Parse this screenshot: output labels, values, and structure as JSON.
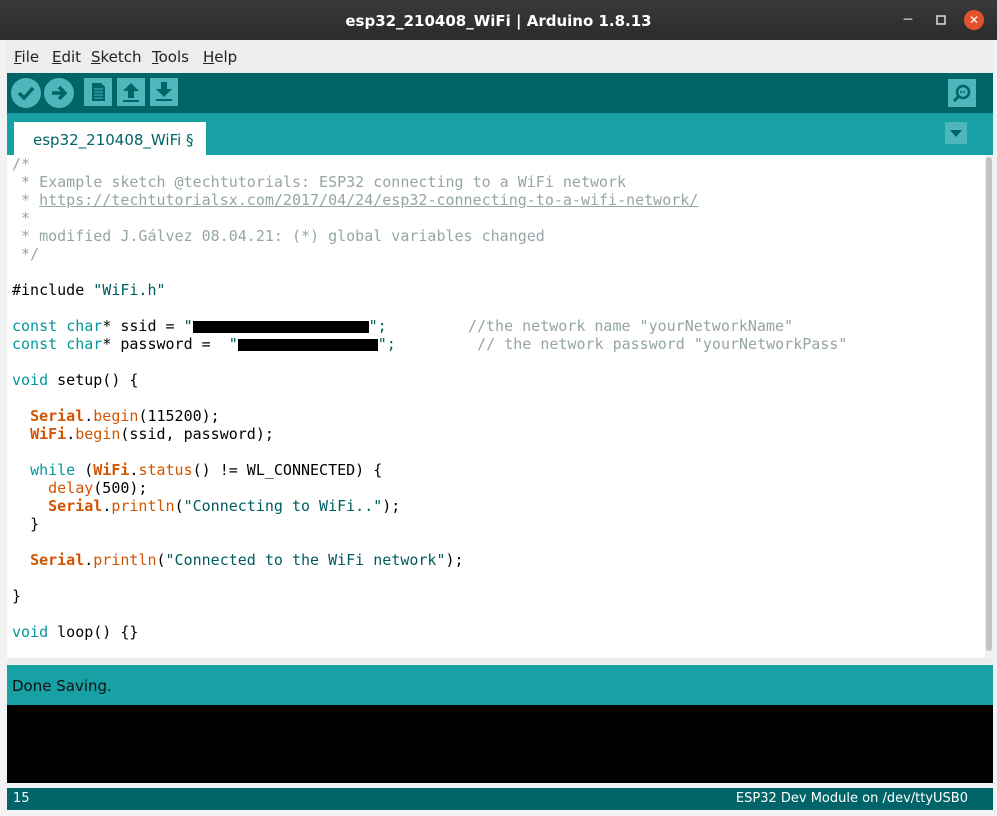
{
  "window": {
    "title": "esp32_210408_WiFi | Arduino 1.8.13"
  },
  "menu": [
    {
      "mnemonic": "F",
      "rest": "ile"
    },
    {
      "mnemonic": "E",
      "rest": "dit"
    },
    {
      "mnemonic": "S",
      "rest": "ketch"
    },
    {
      "mnemonic": "T",
      "rest": "ools"
    },
    {
      "mnemonic": "H",
      "rest": "elp"
    }
  ],
  "tab": {
    "label": "esp32_210408_WiFi §"
  },
  "code": {
    "l1": "/*",
    "l2": " * Example sketch @techtutorials: ESP32 connecting to a WiFi network",
    "l3_prefix": " * ",
    "l3_url": "https://techtutorialsx.com/2017/04/24/esp32-connecting-to-a-wifi-network/",
    "l4": " *",
    "l5": " * modified J.Gálvez 08.04.21: (*) global variables changed",
    "l6": " */",
    "inc_kw": "#include",
    "inc_str": " \"WiFi.h\"",
    "const": "const",
    "char": "char",
    "ssid_mid": "* ssid = ",
    "password_mid": "* password =  ",
    "q": "\"",
    "end_q": "\";",
    "ssid_comment": "         //the network name \"yourNetworkName\"",
    "pass_comment": "         // the network password \"yourNetworkPass\"",
    "void": "void",
    "setup_sig": " setup() {",
    "serial": "Serial",
    "wifi": "WiFi",
    "begin": "begin",
    "baud": "(115200);",
    "wifi_args": "(ssid, password);",
    "while": "while",
    "status": "status",
    "status_rest": "() != WL_CONNECTED) {",
    "delay": "delay",
    "delay_args": "(500);",
    "println": "println",
    "connecting_str": "\"Connecting to WiFi..\"",
    "connected_str": "\"Connected to the WiFi network\"",
    "close_paren": ");",
    "brace_close": "}",
    "loop_sig": " loop() {}"
  },
  "status_message": "Done Saving.",
  "footer": {
    "line_number": "15",
    "board": "ESP32 Dev Module on /dev/ttyUSB0"
  },
  "colors": {
    "toolbar": "#006468",
    "tabstrip": "#17a1a5",
    "button": "#4db7bb",
    "keyword": "#00979c",
    "object": "#d35400",
    "comment": "#95a5a6"
  }
}
